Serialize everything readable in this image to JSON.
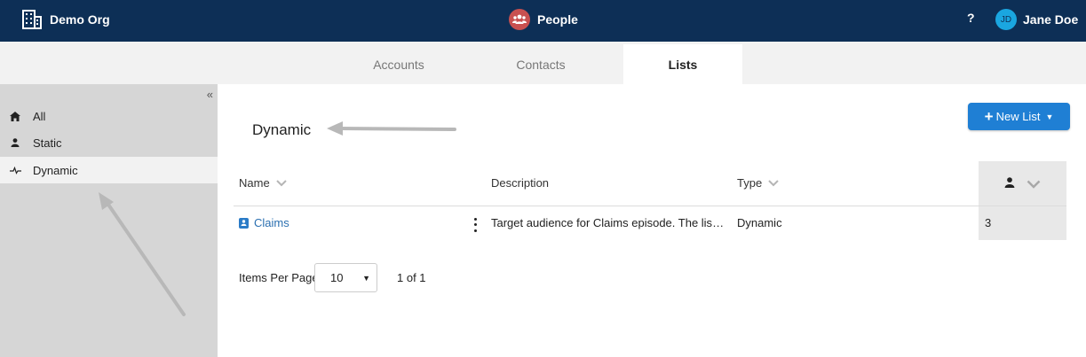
{
  "header": {
    "org_name": "Demo Org",
    "app_name": "People",
    "help_label": "?",
    "user_initials": "JD",
    "user_name": "Jane Doe",
    "icons": {
      "org": "building-icon",
      "app": "people-icon"
    }
  },
  "tabs": [
    {
      "label": "Accounts",
      "active": false
    },
    {
      "label": "Contacts",
      "active": false
    },
    {
      "label": "Lists",
      "active": true
    }
  ],
  "sidebar": {
    "collapse_glyph": "«",
    "items": [
      {
        "label": "All",
        "icon": "home-icon",
        "active": false
      },
      {
        "label": "Static",
        "icon": "person-icon",
        "active": false
      },
      {
        "label": "Dynamic",
        "icon": "pulse-icon",
        "active": true
      }
    ]
  },
  "main": {
    "title": "Dynamic",
    "new_list_button": {
      "plus": "+",
      "label": "New List",
      "caret": "▼"
    },
    "columns": {
      "name": "Name",
      "description": "Description",
      "type": "Type"
    },
    "rows": [
      {
        "name": "Claims",
        "description": "Target audience for Claims episode. The list contains members with open claims",
        "type": "Dynamic",
        "count": "3"
      }
    ],
    "pagination": {
      "items_per_page_label": "Items Per Page",
      "items_per_page_value": "10",
      "select_arrow": "▼",
      "page_info": "1 of 1"
    }
  },
  "colors": {
    "header_bg": "#0d2f56",
    "accent": "#1f7fd4",
    "link": "#2a6fb0",
    "sidebar_bg": "#d6d6d6",
    "app_icon_bg": "#c85050",
    "avatar_bg": "#1aa6e0"
  }
}
